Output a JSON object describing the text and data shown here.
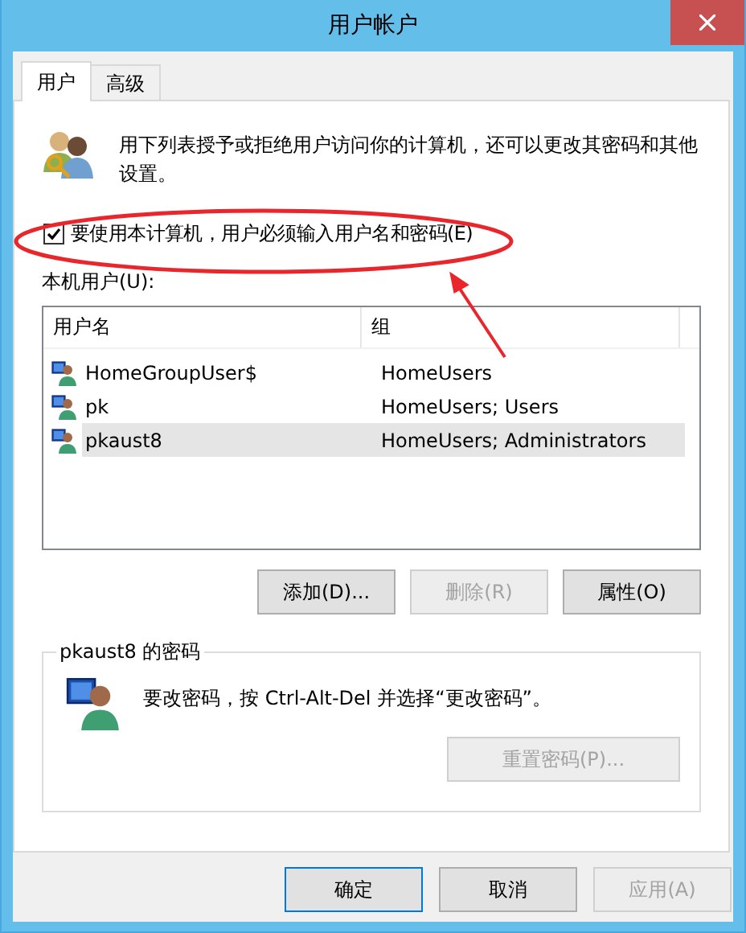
{
  "window": {
    "title": "用户帐户"
  },
  "tabs": [
    {
      "label": "用户",
      "selected": true
    },
    {
      "label": "高级",
      "selected": false
    }
  ],
  "intro": "用下列表授予或拒绝用户访问你的计算机，还可以更改其密码和其他设置。",
  "require_password": {
    "label": "要使用本计算机，用户必须输入用户名和密码(E)",
    "checked": true
  },
  "users_label": "本机用户(U):",
  "table": {
    "columns": [
      "用户名",
      "组"
    ],
    "rows": [
      {
        "cells": [
          "HomeGroupUser$",
          "HomeUsers"
        ],
        "selected": false
      },
      {
        "cells": [
          "pk",
          "HomeUsers; Users"
        ],
        "selected": false
      },
      {
        "cells": [
          "pkaust8",
          "HomeUsers; Administrators"
        ],
        "selected": true
      }
    ]
  },
  "user_buttons": [
    {
      "label": "添加(D)...",
      "disabled": false
    },
    {
      "label": "删除(R)",
      "disabled": true
    },
    {
      "label": "属性(O)",
      "disabled": false
    }
  ],
  "password_group": {
    "title": "pkaust8 的密码",
    "message": "要改密码，按 Ctrl-Alt-Del 并选择“更改密码”。",
    "button": {
      "label": "重置密码(P)...",
      "disabled": true
    }
  },
  "dialog_buttons": [
    {
      "label": "确定",
      "disabled": false,
      "default": true
    },
    {
      "label": "取消",
      "disabled": false,
      "default": false
    },
    {
      "label": "应用(A)",
      "disabled": true,
      "default": false
    }
  ],
  "annotations": {
    "highlight_ellipse": true,
    "arrow": true
  }
}
